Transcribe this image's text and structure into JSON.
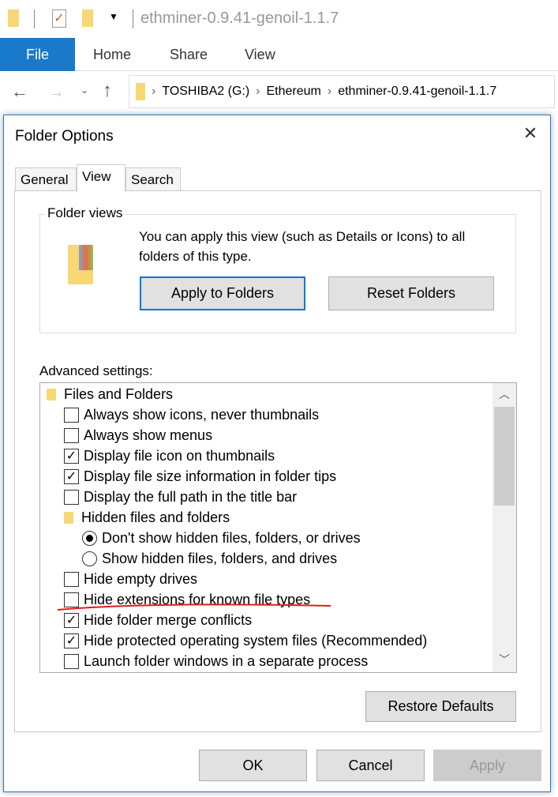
{
  "explorer": {
    "title": "ethminer-0.9.41-genoil-1.1.7",
    "ribbon_tabs": [
      "File",
      "Home",
      "Share",
      "View"
    ],
    "breadcrumb": [
      "TOSHIBA2 (G:)",
      "Ethereum",
      "ethminer-0.9.41-genoil-1.1.7"
    ],
    "accent": "#1979ca"
  },
  "dialog": {
    "title": "Folder Options",
    "tabs": [
      "General",
      "View",
      "Search"
    ],
    "selected_tab": "View",
    "folder_views": {
      "label": "Folder views",
      "description": "You can apply this view (such as Details or Icons) to all folders of this type.",
      "apply_button": "Apply to Folders",
      "reset_button": "Reset Folders"
    },
    "advanced_label": "Advanced settings:",
    "items": [
      {
        "type": "folder",
        "label": "Files and Folders",
        "indent": 0
      },
      {
        "type": "checkbox",
        "label": "Always show icons, never thumbnails",
        "checked": false,
        "indent": 1
      },
      {
        "type": "checkbox",
        "label": "Always show menus",
        "checked": false,
        "indent": 1
      },
      {
        "type": "checkbox",
        "label": "Display file icon on thumbnails",
        "checked": true,
        "indent": 1
      },
      {
        "type": "checkbox",
        "label": "Display file size information in folder tips",
        "checked": true,
        "indent": 1
      },
      {
        "type": "checkbox",
        "label": "Display the full path in the title bar",
        "checked": false,
        "indent": 1
      },
      {
        "type": "folder",
        "label": "Hidden files and folders",
        "indent": 1
      },
      {
        "type": "radio",
        "label": "Don't show hidden files, folders, or drives",
        "checked": true,
        "indent": 2
      },
      {
        "type": "radio",
        "label": "Show hidden files, folders, and drives",
        "checked": false,
        "indent": 2
      },
      {
        "type": "checkbox",
        "label": "Hide empty drives",
        "checked": false,
        "indent": 1
      },
      {
        "type": "checkbox",
        "label": "Hide extensions for known file types",
        "checked": false,
        "indent": 1,
        "annotated": true
      },
      {
        "type": "checkbox",
        "label": "Hide folder merge conflicts",
        "checked": true,
        "indent": 1
      },
      {
        "type": "checkbox",
        "label": "Hide protected operating system files (Recommended)",
        "checked": true,
        "indent": 1
      },
      {
        "type": "checkbox",
        "label": "Launch folder windows in a separate process",
        "checked": false,
        "indent": 1
      }
    ],
    "restore_button": "Restore Defaults",
    "ok_button": "OK",
    "cancel_button": "Cancel",
    "apply_button": "Apply"
  }
}
